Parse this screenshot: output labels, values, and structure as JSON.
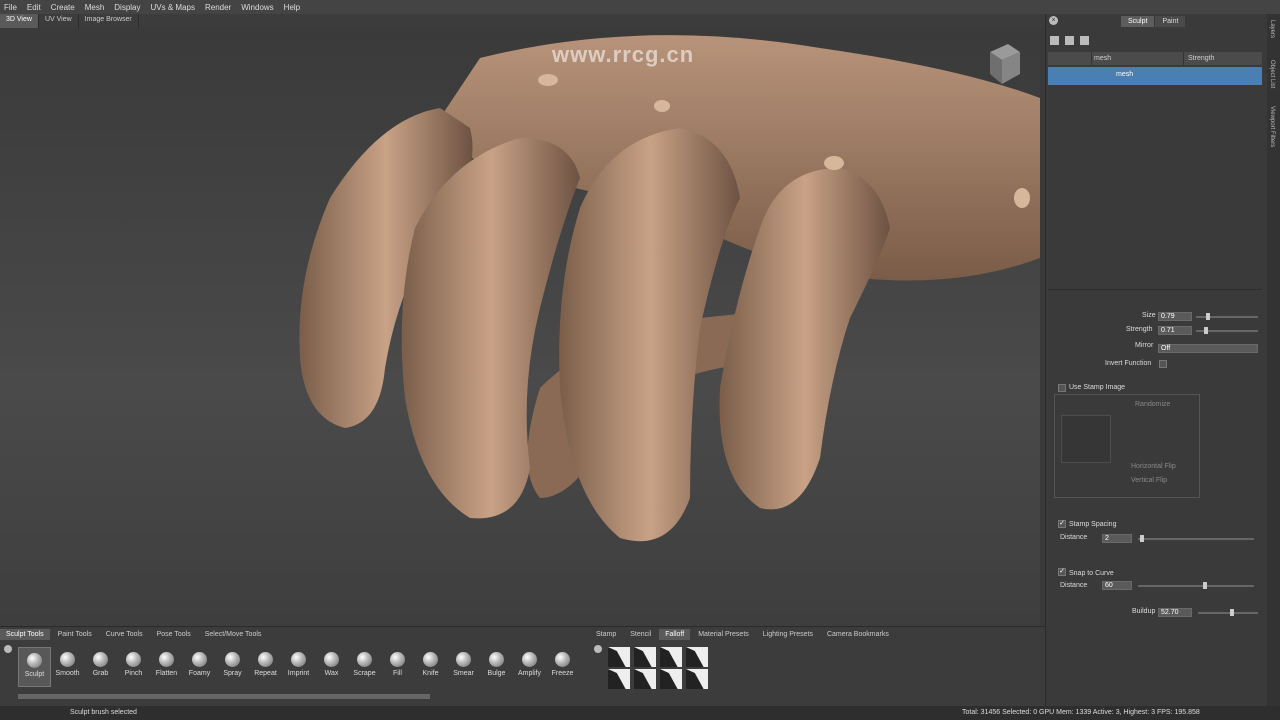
{
  "menu": [
    "File",
    "Edit",
    "Create",
    "Mesh",
    "Display",
    "UVs & Maps",
    "Render",
    "Windows",
    "Help"
  ],
  "view_tabs": [
    "3D View",
    "UV View",
    "Image Browser"
  ],
  "watermark_url": "www.rrcg.cn",
  "right_tabs": [
    "Sculpt",
    "Paint"
  ],
  "side_strip": [
    "Layers",
    "Object List",
    "Viewport Filters"
  ],
  "layers": {
    "col_name": "mesh",
    "col_strength": "Strength",
    "row_name": "mesh"
  },
  "props": {
    "size_label": "Size",
    "size_value": "0.79",
    "strength_label": "Strength",
    "strength_value": "0.71",
    "mirror_label": "Mirror",
    "mirror_value": "Off",
    "invert_label": "Invert Function",
    "stamp_image_label": "Use Stamp Image",
    "randomize_label": "Randomize",
    "hflip_label": "Horizontal Flip",
    "vflip_label": "Vertical Flip",
    "stamp_spacing_label": "Stamp Spacing",
    "distance_label": "Distance",
    "distance_value": "2",
    "snap_label": "Snap to Curve",
    "snap_distance_label": "Distance",
    "snap_distance_value": "60",
    "buildup_label": "Buildup",
    "buildup_value": "52.70"
  },
  "bottom_tabs": [
    "Sculpt Tools",
    "Paint Tools",
    "Curve Tools",
    "Pose Tools",
    "Select/Move Tools"
  ],
  "tools": [
    "Sculpt",
    "Smooth",
    "Grab",
    "Pinch",
    "Flatten",
    "Foamy",
    "Spray",
    "Repeat",
    "Imprint",
    "Wax",
    "Scrape",
    "Fill",
    "Knife",
    "Smear",
    "Bulge",
    "Amplify",
    "Freeze"
  ],
  "right_bottom_tabs": [
    "Stamp",
    "Stencil",
    "Falloff",
    "Material Presets",
    "Lighting Presets",
    "Camera Bookmarks"
  ],
  "status": {
    "left": "Sculpt brush selected",
    "right": "Total: 31456  Selected: 0 GPU Mem: 1339  Active: 3, Highest: 3  FPS: 195.858"
  },
  "colors": {
    "accent": "#4a7fb3",
    "skin": "#b08b70"
  }
}
